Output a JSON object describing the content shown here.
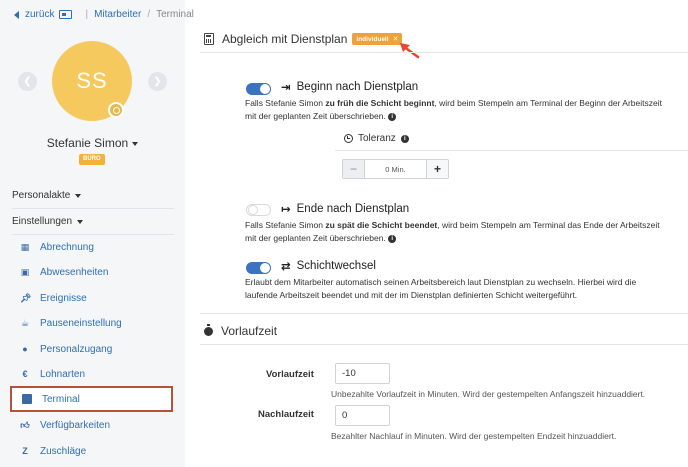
{
  "breadcrumb": {
    "back": "zurück",
    "employees": "Mitarbeiter",
    "current": "Terminal"
  },
  "profile": {
    "initials": "SS",
    "name": "Stefanie Simon",
    "tag": "BÜRO",
    "avatar_color": "#f6c95f"
  },
  "sidebar": {
    "section_personnel": "Personalakte",
    "section_settings": "Einstellungen",
    "items": [
      {
        "label": "Abrechnung",
        "icon": "calculator-icon"
      },
      {
        "label": "Abwesenheiten",
        "icon": "calendar-x-icon"
      },
      {
        "label": "Ereignisse",
        "icon": "pin-icon"
      },
      {
        "label": "Pauseneinstellung",
        "icon": "coffee-icon"
      },
      {
        "label": "Personalzugang",
        "icon": "users-icon"
      },
      {
        "label": "Lohnarten",
        "icon": "euro-icon"
      },
      {
        "label": "Terminal",
        "icon": "tablet-icon"
      },
      {
        "label": "Verfügbarkeiten",
        "icon": "thumbs-up-icon"
      },
      {
        "label": "Zuschläge",
        "icon": "z-icon"
      }
    ]
  },
  "main": {
    "title": "Abgleich mit Dienstplan",
    "badge": "individuell",
    "options": {
      "start": {
        "title": "Beginn nach Dienstplan",
        "enabled": true,
        "desc_pre": "Falls Stefanie Simon ",
        "desc_bold": "zu früh die Schicht beginnt",
        "desc_post": ", wird beim Stempeln am Terminal der Beginn der Arbeitszeit mit der geplanten Zeit überschrieben."
      },
      "tolerance": {
        "label": "Toleranz",
        "value": "0 Min.",
        "minus": "−",
        "plus": "+"
      },
      "end": {
        "title": "Ende nach Dienstplan",
        "enabled": false,
        "desc_pre": "Falls Stefanie Simon ",
        "desc_bold": "zu spät die Schicht beendet",
        "desc_post": ", wird beim Stempeln am Terminal das Ende der Arbeitszeit mit der geplanten Zeit überschrieben."
      },
      "shift_change": {
        "title": "Schichtwechsel",
        "enabled": true,
        "desc": "Erlaubt dem Mitarbeiter automatisch seinen Arbeitsbereich laut Dienstplan zu wechseln. Hierbei wird die laufende Arbeitszeit beendet und mit der im Dienstplan definierten Schicht weitergeführt."
      }
    },
    "lead_section": {
      "title": "Vorlaufzeit",
      "lead_label": "Vorlaufzeit",
      "lead_value": "-10",
      "lead_help": "Unbezahlte Vorlaufzeit in Minuten. Wird der gestempelten Anfangszeit hinzuaddiert.",
      "trail_label": "Nachlaufzeit",
      "trail_value": "0",
      "trail_help": "Bezahlter Nachlauf in Minuten. Wird der gestempelten Endzeit hinzuaddiert."
    }
  },
  "colors": {
    "accent": "#3c73c0",
    "badge": "#eea23a",
    "highlight": "#b5533a",
    "annotation": "#e8472f"
  }
}
